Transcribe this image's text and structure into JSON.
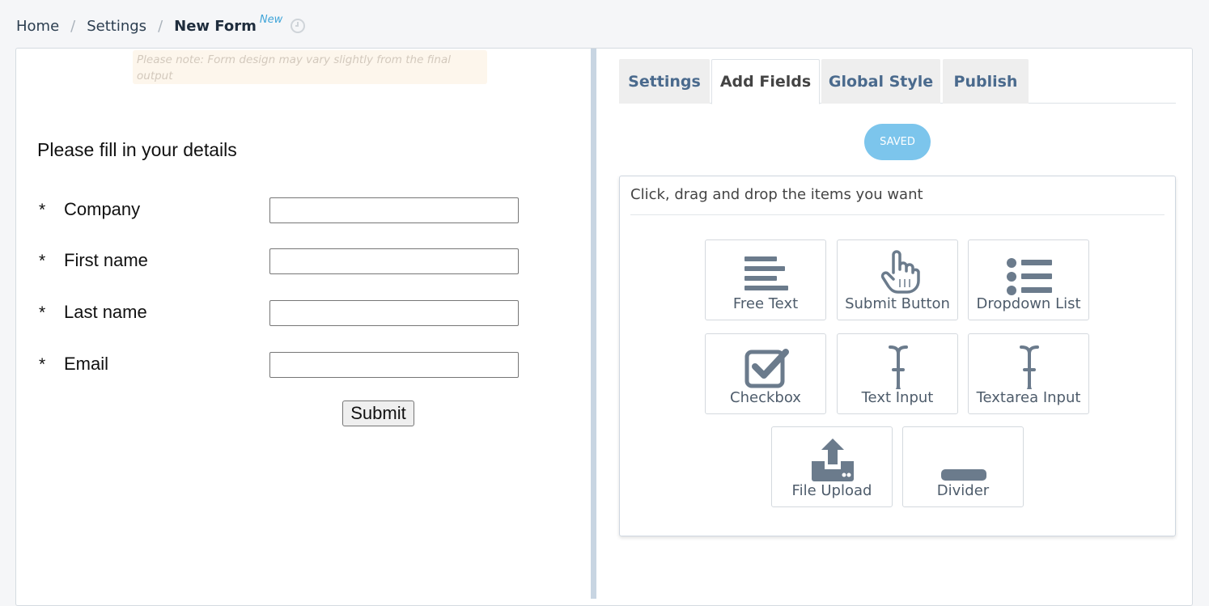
{
  "breadcrumb": {
    "home": "Home",
    "settings": "Settings",
    "current": "New Form",
    "badge": "New"
  },
  "preview": {
    "note": "Please note: Form design may vary slightly from the final output",
    "title": "Please fill in your details",
    "required_mark": "*",
    "fields": [
      {
        "label": "Company",
        "value": ""
      },
      {
        "label": "First name",
        "value": ""
      },
      {
        "label": "Last name",
        "value": ""
      },
      {
        "label": "Email",
        "value": ""
      }
    ],
    "submit_label": "Submit"
  },
  "tabs": [
    {
      "label": "Settings",
      "active": false
    },
    {
      "label": "Add Fields",
      "active": true
    },
    {
      "label": "Global Style",
      "active": false
    },
    {
      "label": "Publish",
      "active": false
    }
  ],
  "saved_label": "SAVED",
  "add_fields": {
    "instruction": "Click, drag and drop the items you want",
    "items": [
      {
        "label": "Free Text",
        "icon": "free-text-icon"
      },
      {
        "label": "Submit Button",
        "icon": "pointer-hand-icon"
      },
      {
        "label": "Dropdown List",
        "icon": "list-icon"
      },
      {
        "label": "Checkbox",
        "icon": "checkbox-icon"
      },
      {
        "label": "Text Input",
        "icon": "text-cursor-icon"
      },
      {
        "label": "Textarea Input",
        "icon": "text-cursor-icon"
      },
      {
        "label": "File Upload",
        "icon": "upload-icon"
      },
      {
        "label": "Divider",
        "icon": "divider-icon"
      }
    ]
  },
  "colors": {
    "accent": "#4a6a8d",
    "saved": "#7cc5ec",
    "icon": "#6b7b8c",
    "badge": "#3fa4d8"
  }
}
